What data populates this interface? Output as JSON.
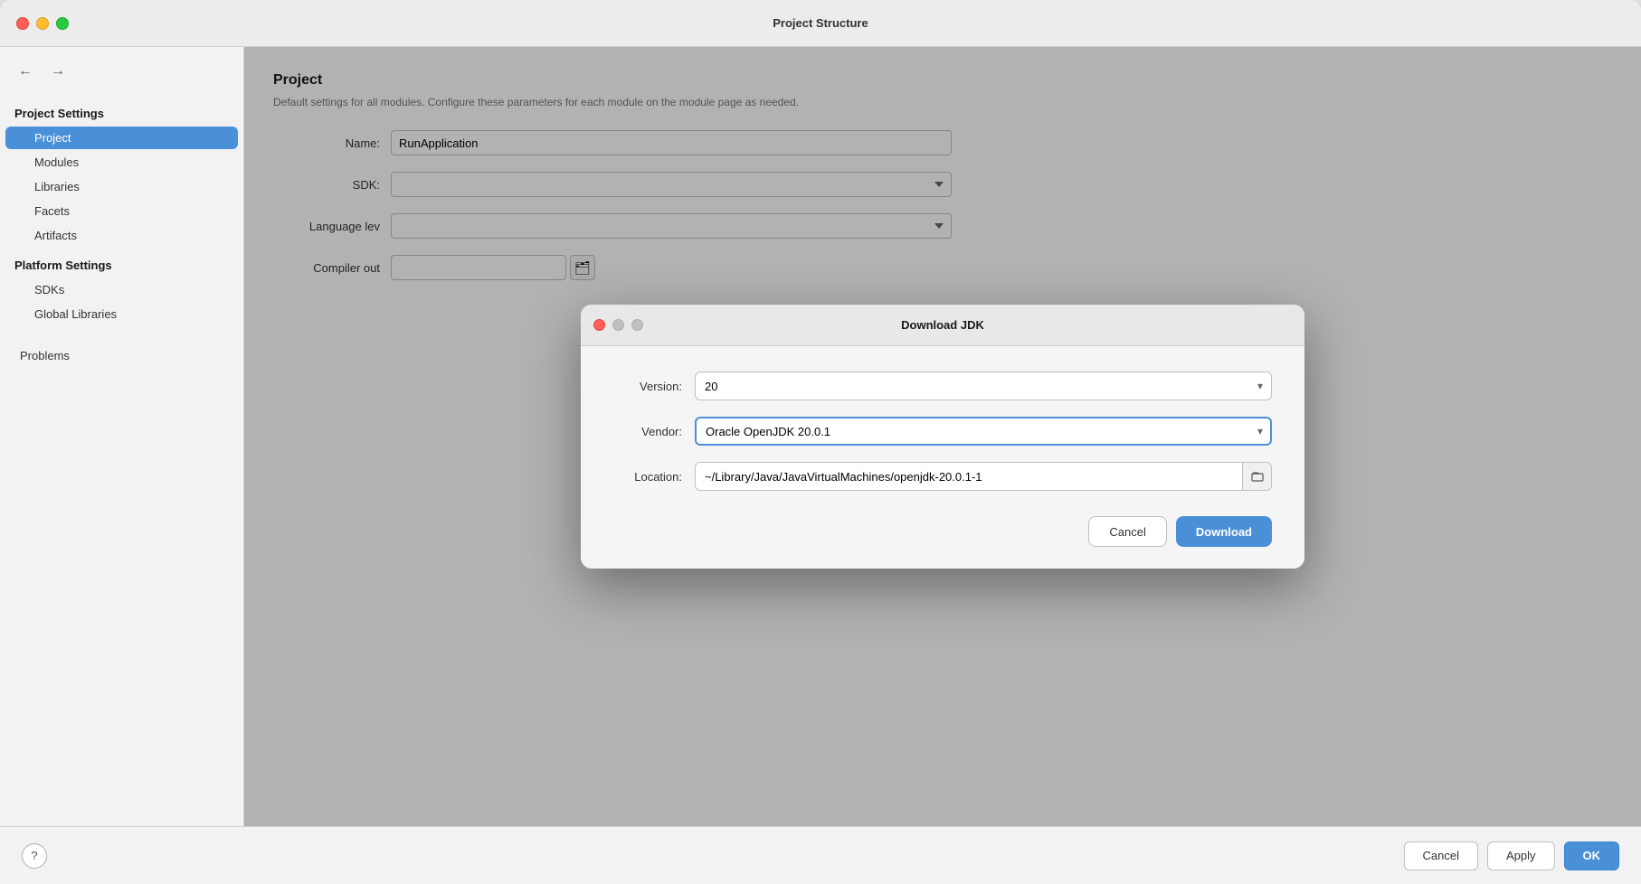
{
  "window": {
    "title": "Project Structure"
  },
  "sidebar": {
    "back_label": "←",
    "forward_label": "→",
    "project_settings_label": "Project Settings",
    "items": [
      {
        "id": "project",
        "label": "Project",
        "active": true
      },
      {
        "id": "modules",
        "label": "Modules",
        "active": false
      },
      {
        "id": "libraries",
        "label": "Libraries",
        "active": false
      },
      {
        "id": "facets",
        "label": "Facets",
        "active": false
      },
      {
        "id": "artifacts",
        "label": "Artifacts",
        "active": false
      }
    ],
    "platform_settings_label": "Platform Settings",
    "platform_items": [
      {
        "id": "sdks",
        "label": "SDKs",
        "active": false
      },
      {
        "id": "global-libraries",
        "label": "Global Libraries",
        "active": false
      }
    ],
    "problems_label": "Problems"
  },
  "main_panel": {
    "title": "Project",
    "description": "Default settings for all modules. Configure these parameters for each module on the module page as needed.",
    "name_label": "Name:",
    "name_value": "RunApplication",
    "sdk_label": "SDK:",
    "language_level_label": "Language lev",
    "compiler_output_label": "Compiler out"
  },
  "footer": {
    "help_label": "?",
    "cancel_label": "Cancel",
    "apply_label": "Apply",
    "ok_label": "OK"
  },
  "modal": {
    "title": "Download JDK",
    "version_label": "Version:",
    "version_value": "20",
    "vendor_label": "Vendor:",
    "vendor_value": "Oracle OpenJDK",
    "vendor_version": "20.0.1",
    "location_label": "Location:",
    "location_value": "~/Library/Java/JavaVirtualMachines/openjdk-20.0.1-1",
    "cancel_label": "Cancel",
    "download_label": "Download"
  }
}
